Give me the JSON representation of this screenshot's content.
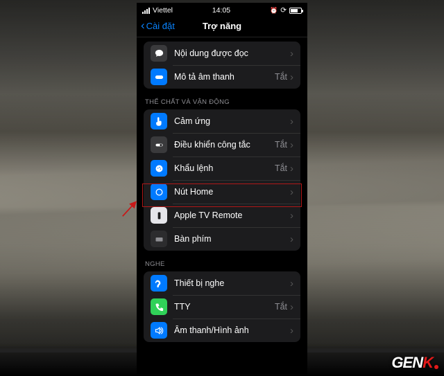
{
  "status": {
    "carrier": "Viettel",
    "time": "14:05"
  },
  "nav": {
    "back": "Cài đặt",
    "title": "Trợ năng"
  },
  "groups": [
    {
      "header": "",
      "rows": [
        {
          "icon": "speech",
          "bg": "ic-gray",
          "label": "Nội dung được đọc",
          "value": ""
        },
        {
          "icon": "audio-desc",
          "bg": "ic-blue",
          "label": "Mô tả âm thanh",
          "value": "Tắt"
        }
      ]
    },
    {
      "header": "THỂ CHẤT VÀ VẬN ĐỘNG",
      "rows": [
        {
          "icon": "touch",
          "bg": "ic-blue",
          "label": "Cảm ứng",
          "value": ""
        },
        {
          "icon": "switch",
          "bg": "ic-gray",
          "label": "Điều khiển công tắc",
          "value": "Tắt"
        },
        {
          "icon": "voice",
          "bg": "ic-blue",
          "label": "Khẩu lệnh",
          "value": "Tắt"
        },
        {
          "icon": "home",
          "bg": "ic-blue",
          "label": "Nút Home",
          "value": ""
        },
        {
          "icon": "remote",
          "bg": "ic-white",
          "label": "Apple TV Remote",
          "value": ""
        },
        {
          "icon": "keyboard",
          "bg": "ic-darkgray",
          "label": "Bàn phím",
          "value": ""
        }
      ]
    },
    {
      "header": "NGHE",
      "rows": [
        {
          "icon": "hearing",
          "bg": "ic-blue",
          "label": "Thiết bị nghe",
          "value": ""
        },
        {
          "icon": "tty",
          "bg": "ic-green",
          "label": "TTY",
          "value": "Tắt"
        },
        {
          "icon": "av",
          "bg": "ic-blue",
          "label": "Âm thanh/Hình ảnh",
          "value": ""
        }
      ]
    }
  ],
  "watermark": {
    "white": "GEN",
    "red": "K"
  }
}
